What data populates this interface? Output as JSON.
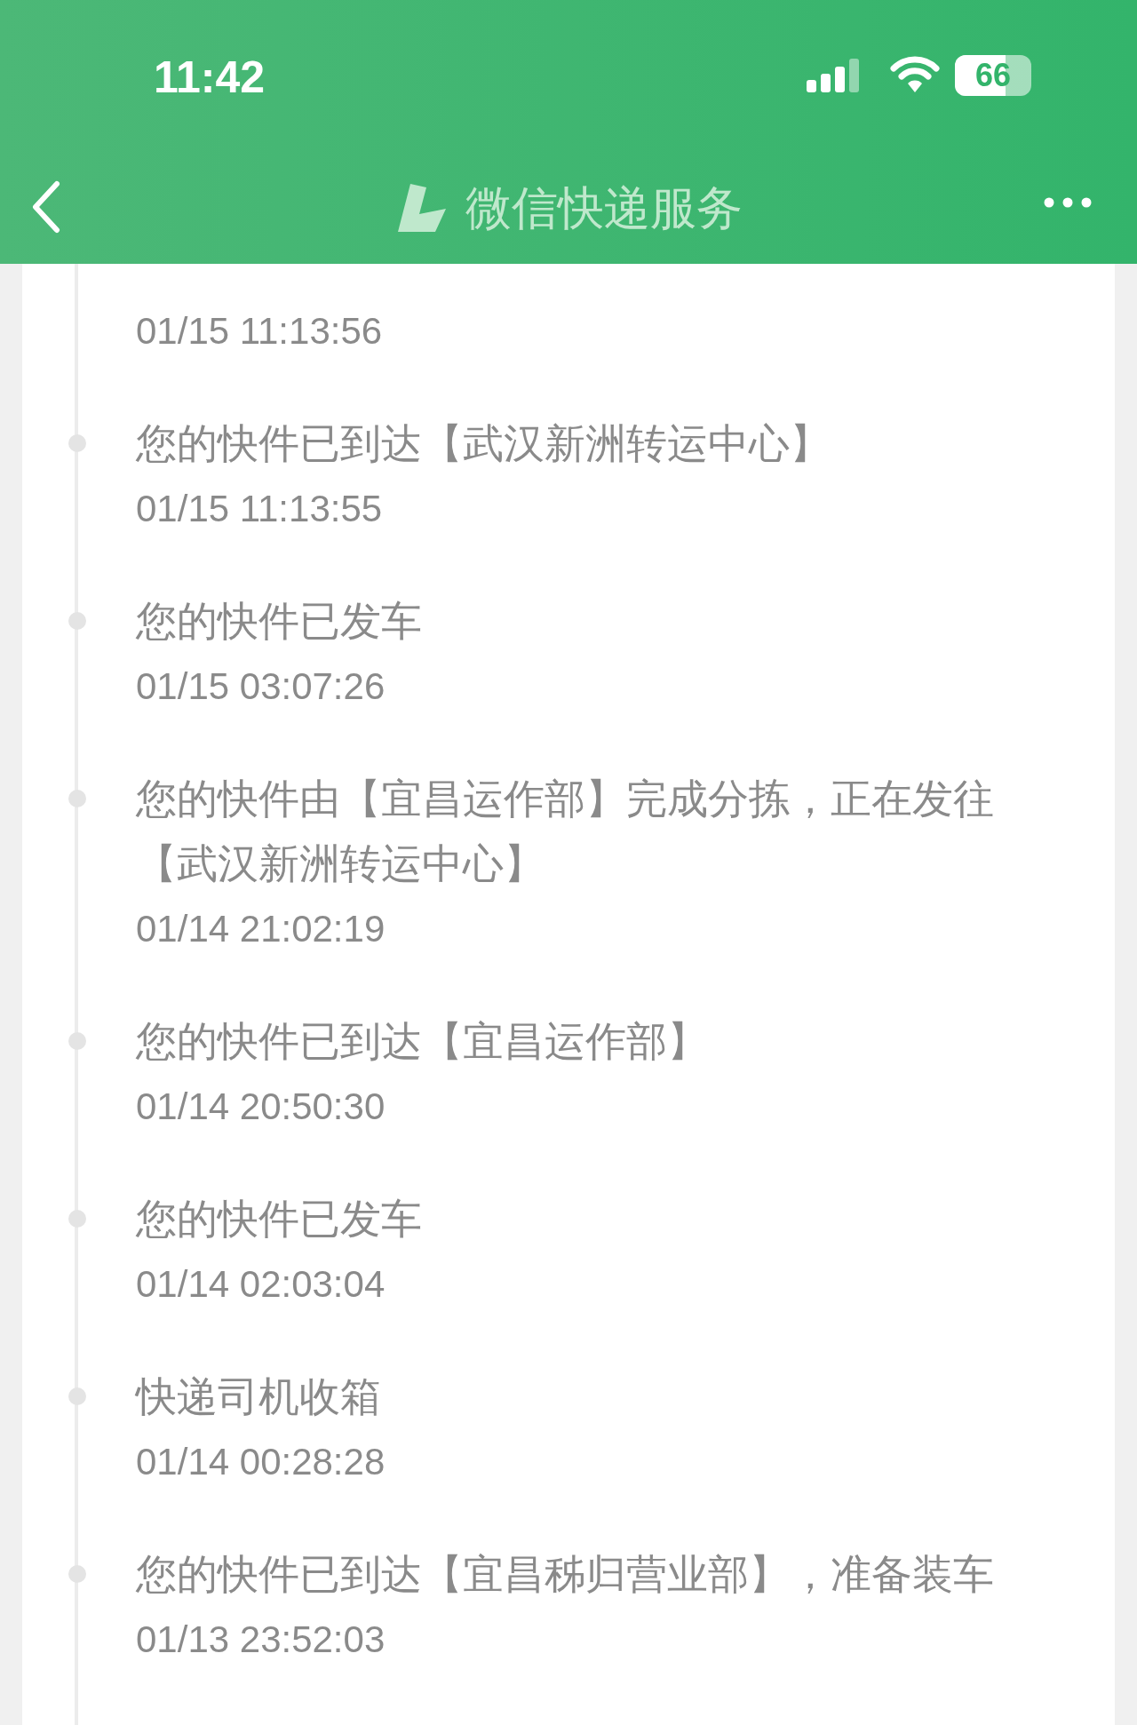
{
  "status_bar": {
    "time": "11:42",
    "battery": "66"
  },
  "header": {
    "title": "微信快递服务"
  },
  "events": [
    {
      "time": "01/15 11:13:56"
    },
    {
      "text": "您的快件已到达【武汉新洲转运中心】",
      "time": "01/15 11:13:55"
    },
    {
      "text": "您的快件已发车",
      "time": "01/15 03:07:26"
    },
    {
      "text": "您的快件由【宜昌运作部】完成分拣，正在发往【武汉新洲转运中心】",
      "time": "01/14 21:02:19"
    },
    {
      "text": "您的快件已到达【宜昌运作部】",
      "time": "01/14 20:50:30"
    },
    {
      "text": "您的快件已发车",
      "time": "01/14 02:03:04"
    },
    {
      "text": "快递司机收箱",
      "time": "01/14 00:28:28"
    },
    {
      "text": "您的快件已到达【宜昌秭归营业部】，准备装车",
      "time": "01/13 23:52:03"
    }
  ]
}
